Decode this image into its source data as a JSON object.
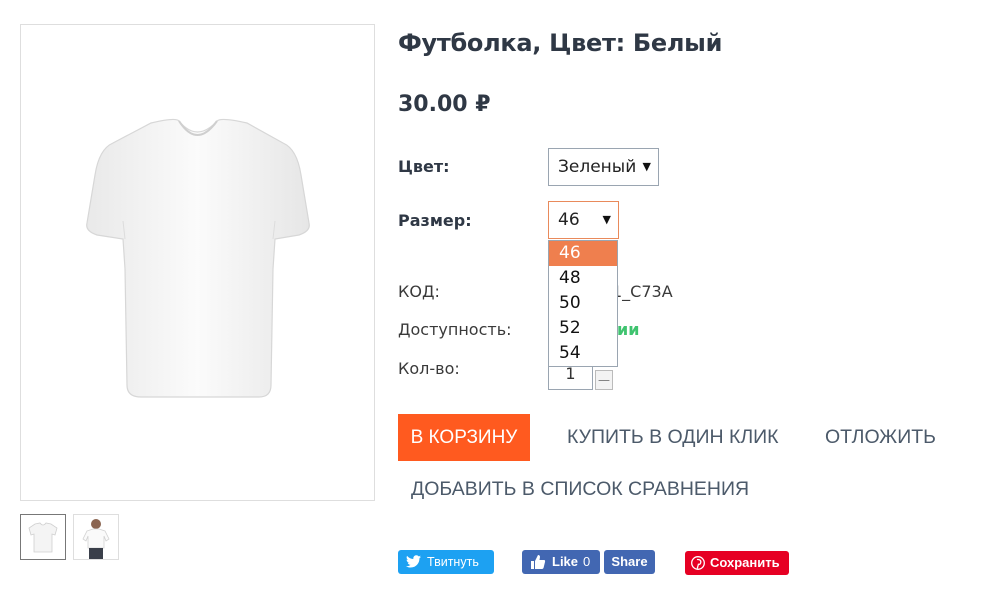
{
  "product": {
    "title": "Футболка, Цвет: Белый",
    "price": "30.00 ₽"
  },
  "options": {
    "color_label": "Цвет:",
    "color_value": "Зеленый",
    "size_label": "Размер:",
    "size_value": "46",
    "size_options": [
      "46",
      "48",
      "50",
      "52",
      "54"
    ]
  },
  "details": {
    "code_label": "КОД:",
    "code_value_visible": "1_C73A",
    "availability_label": "Доступность:",
    "availability_value_visible": "ии",
    "qty_label": "Кол-во:",
    "qty_value": "1",
    "qty_minus": "—"
  },
  "actions": {
    "add_to_cart": "В КОРЗИНУ",
    "buy_one_click": "КУПИТЬ В ОДИН КЛИК",
    "postpone": "ОТЛОЖИТЬ",
    "add_to_compare": "ДОБАВИТЬ В СПИСОК СРАВНЕНИЯ"
  },
  "social": {
    "tweet": "Твитнуть",
    "fb_like": "Like",
    "fb_like_count": "0",
    "fb_share": "Share",
    "pin_save": "Сохранить"
  },
  "colors": {
    "accent": "#ff5a1f",
    "dropdown_highlight": "#ef7f4e",
    "available": "#3fc36f",
    "twitter": "#1da1f2",
    "facebook": "#4267b2",
    "pinterest": "#e60023"
  }
}
